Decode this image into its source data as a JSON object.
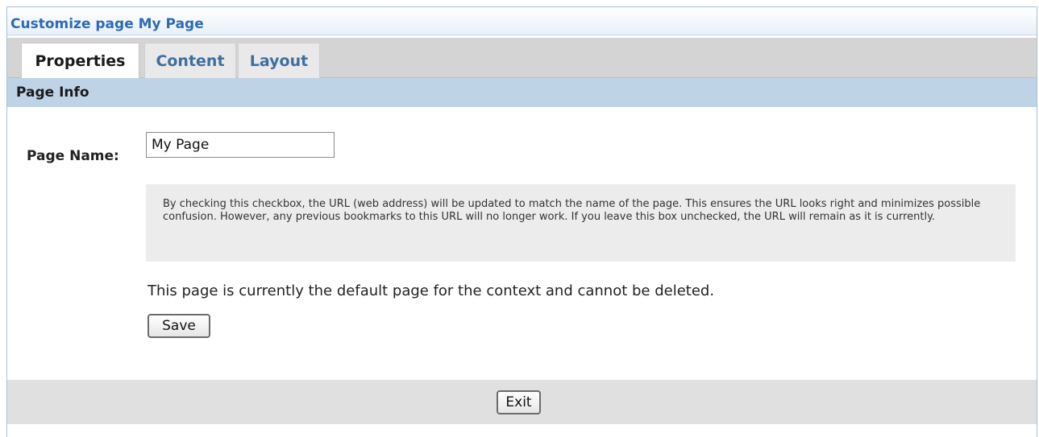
{
  "window": {
    "title": "Customize page My Page"
  },
  "tabs": [
    {
      "label": "Properties",
      "active": true
    },
    {
      "label": "Content",
      "active": false
    },
    {
      "label": "Layout",
      "active": false
    }
  ],
  "section": {
    "title": "Page Info"
  },
  "page_name": {
    "label": "Page Name:",
    "value": "My Page"
  },
  "info_box": {
    "text": "By checking this checkbox, the URL (web address) will be updated to match the name of the page. This ensures the URL looks right and minimizes possible confusion. However, any previous bookmarks to this URL will no longer work. If you leave this box unchecked, the URL will remain as it is currently."
  },
  "default_note": "This page is currently the default page for the context and cannot be deleted.",
  "buttons": {
    "save_label": "Save",
    "exit_label": "Exit"
  },
  "colors": {
    "title_text": "#2f6ab5",
    "inactive_tab_text": "#3f6e9e",
    "section_header_bg": "#bfd3e6",
    "footer_bg": "#e0e0e0"
  }
}
